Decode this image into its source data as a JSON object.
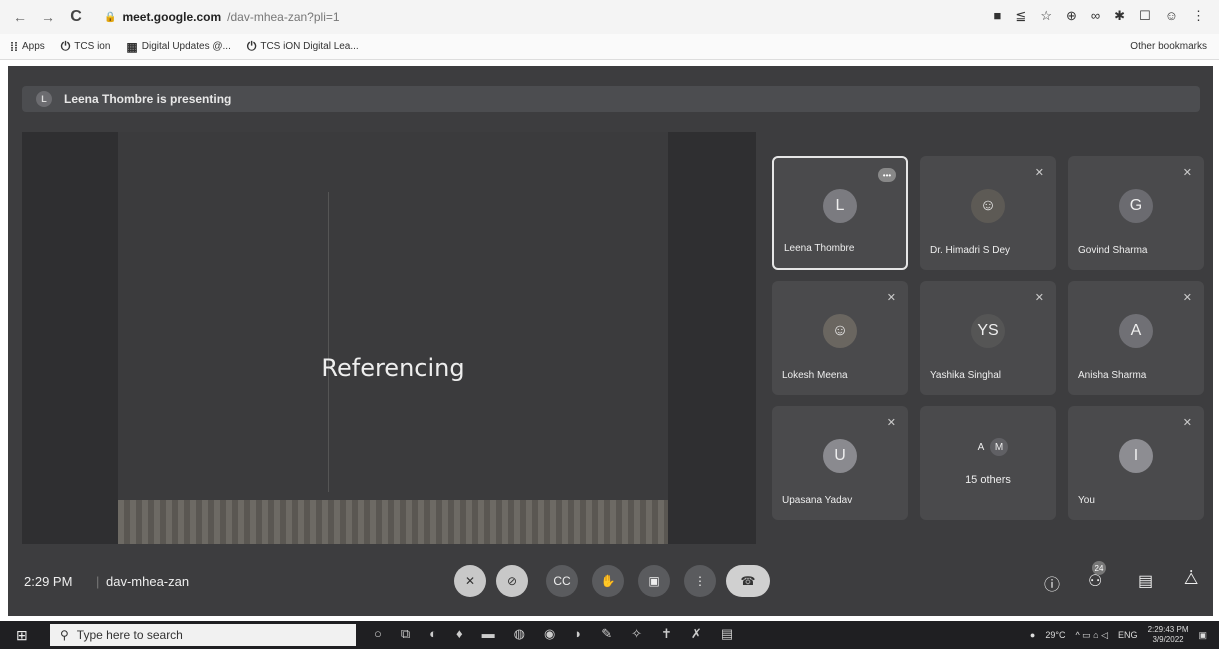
{
  "browser": {
    "back": "←",
    "forward": "→",
    "reload": "C",
    "url_host": "meet.google.com",
    "url_path": "/dav-mhea-zan?pli=1",
    "extensions": [
      "■",
      "≦",
      "☆",
      "⊕",
      "∞",
      "✱",
      "☐",
      "☺",
      "⋮"
    ]
  },
  "bookmarks": {
    "items": [
      {
        "icon": "⁞⁞",
        "label": "Apps"
      },
      {
        "icon": "⏻",
        "label": "TCS ion"
      },
      {
        "icon": "▦",
        "label": "Digital Updates @..."
      },
      {
        "icon": "⏻",
        "label": "TCS iON Digital Lea..."
      }
    ],
    "other": "Other bookmarks"
  },
  "meet": {
    "presenting": "Leena Thombre is presenting",
    "slide_title": "Referencing",
    "tiles": [
      {
        "name": "Leena Thombre",
        "initial": "L",
        "color": "#7b7b80",
        "active": true
      },
      {
        "name": "Dr. Himadri S Dey",
        "initial": "",
        "color": "#5d5a55"
      },
      {
        "name": "Govind Sharma",
        "initial": "G",
        "color": "#6b6b70"
      },
      {
        "name": "Lokesh Meena",
        "initial": "",
        "color": "#6a6660"
      },
      {
        "name": "Yashika Singhal",
        "initial": "YS",
        "color": "#555"
      },
      {
        "name": "Anisha Sharma",
        "initial": "A",
        "color": "#707075"
      },
      {
        "name": "Upasana Yadav",
        "initial": "U",
        "color": "#8a8a8f"
      },
      {
        "name": "15 others",
        "initial": "",
        "color": "#4a4a4c"
      },
      {
        "name": "You",
        "initial": "I",
        "color": "#8d8d92"
      }
    ],
    "others_avatars": [
      "A",
      "M"
    ],
    "time": "2:29 PM",
    "separator": "|",
    "code": "dav-mhea-zan",
    "people_count": "24"
  },
  "taskbar": {
    "search_placeholder": "Type here to search",
    "weather": "29°C",
    "lang": "ENG",
    "time": "2:29:43 PM",
    "date": "3/9/2022"
  }
}
